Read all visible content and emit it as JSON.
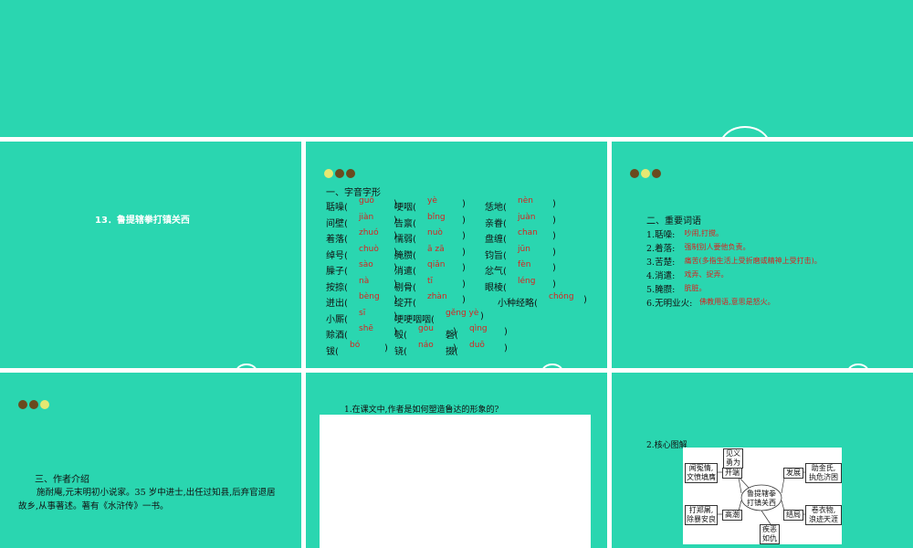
{
  "slide2": {
    "title": "13．鲁提辖拳打镇关西"
  },
  "slide3": {
    "heading": "一、字音字形",
    "rows": [
      [
        {
          "w": "聒噪(",
          "p": "guō",
          "c": ")"
        },
        {
          "w": "哽咽(",
          "p": "yè",
          "c": ")"
        },
        {
          "w": "恁地(",
          "p": "nèn",
          "c": ")"
        }
      ],
      [
        {
          "w": "间壁(",
          "p": "jiàn",
          "c": ")"
        },
        {
          "w": "告禀(",
          "p": "bǐng",
          "c": ")"
        },
        {
          "w": "亲眷(",
          "p": "juàn",
          "c": ")"
        }
      ],
      [
        {
          "w": "着落(",
          "p": "zhuó",
          "c": ")"
        },
        {
          "w": "懦弱(",
          "p": "nuò",
          "c": ")"
        },
        {
          "w": "盘缠(",
          "p": "chan",
          "c": ")"
        }
      ],
      [
        {
          "w": "绰号(",
          "p": "chuò",
          "c": ")"
        },
        {
          "w": "腌臜(",
          "p": "ā zā",
          "c": ")"
        },
        {
          "w": "钧旨(",
          "p": "jūn",
          "c": ")"
        }
      ],
      [
        {
          "w": "臊子(",
          "p": "sào",
          "c": ")"
        },
        {
          "w": "消遣(",
          "p": "qiǎn",
          "c": ")"
        },
        {
          "w": "忿气(",
          "p": "fèn",
          "c": ")"
        }
      ],
      [
        {
          "w": "按捺(",
          "p": "nà",
          "c": ")"
        },
        {
          "w": "剔骨(",
          "p": "tī",
          "c": ")"
        },
        {
          "w": "眼棱(",
          "p": "léng",
          "c": ")"
        }
      ],
      [
        {
          "w": "迸出(",
          "p": "bèng",
          "c": ")"
        },
        {
          "w": "绽开(",
          "p": "zhàn",
          "c": ")"
        },
        {
          "w": "小种经略(",
          "p": "chóng",
          "c": ")"
        }
      ],
      [
        {
          "w": "小厮(",
          "p": "sī",
          "c": ")"
        },
        {
          "w": "哽哽咽咽(",
          "p": "gěng yè",
          "c": ")"
        }
      ],
      [
        {
          "w": "赊酒(",
          "p": "shē",
          "c": ")"
        },
        {
          "w": "彀(",
          "p": "gòu",
          "c": ")"
        },
        {
          "w": "磬(",
          "p": "qìng",
          "c": ")"
        }
      ],
      [
        {
          "w": "钹(",
          "p": "bó",
          "c": ")"
        },
        {
          "w": "铙(",
          "p": "náo",
          "c": ")"
        },
        {
          "w": "掇(",
          "p": "duō",
          "c": ")"
        }
      ]
    ]
  },
  "slide4": {
    "heading": "二、重要词语",
    "items": [
      {
        "term": "1.聒噪:",
        "def": "吵闹,打搅。"
      },
      {
        "term": "2.着落:",
        "def": "强制别人要他负责。"
      },
      {
        "term": "3.苦楚:",
        "def": "痛苦(多指生活上受折磨或精神上受打击)。"
      },
      {
        "term": "4.消遣:",
        "def": "戏弄、捉弄。"
      },
      {
        "term": "5.腌臜:",
        "def": "肮脏。"
      },
      {
        "term": "6.无明业火:",
        "def": "佛教用语,意思是怒火。"
      }
    ]
  },
  "slide5": {
    "heading": "三、作者介绍",
    "para1": "施耐庵,元末明初小说家。35 岁中进士,出任过知县,后弃官退居",
    "para2": "故乡,从事著述。著有《水浒传》一书。"
  },
  "slide6": {
    "question": "1.在课文中,作者是如何塑造鲁达的形象的?"
  },
  "slide7": {
    "heading": "2.核心图解",
    "center": [
      "鲁提辖拳",
      "打镇关西"
    ],
    "nodes": {
      "n_jianwen": [
        "见义",
        "勇为"
      ],
      "n_kaiduan": [
        "开端"
      ],
      "n_wenkunqing": [
        "闻冤情,",
        "文愤填膺"
      ],
      "n_fazhan": [
        "发展"
      ],
      "n_zhujinshi": [
        "助金氏,",
        "执危济困"
      ],
      "n_gaochao": [
        "高潮"
      ],
      "n_dazheng": [
        "打郑屠,",
        "除暴安良"
      ],
      "n_jieju": [
        "结局"
      ],
      "n_juanyiwu": [
        "卷衣物,",
        "浪迹天涯"
      ],
      "n_jiee": [
        "疾恶",
        "如仇"
      ]
    }
  },
  "colors": {
    "slide_bg": "#2ad6b0",
    "pinyin": "#d8231f",
    "dot_dark": "#6a4a1e",
    "dot_light": "#e6e872"
  }
}
